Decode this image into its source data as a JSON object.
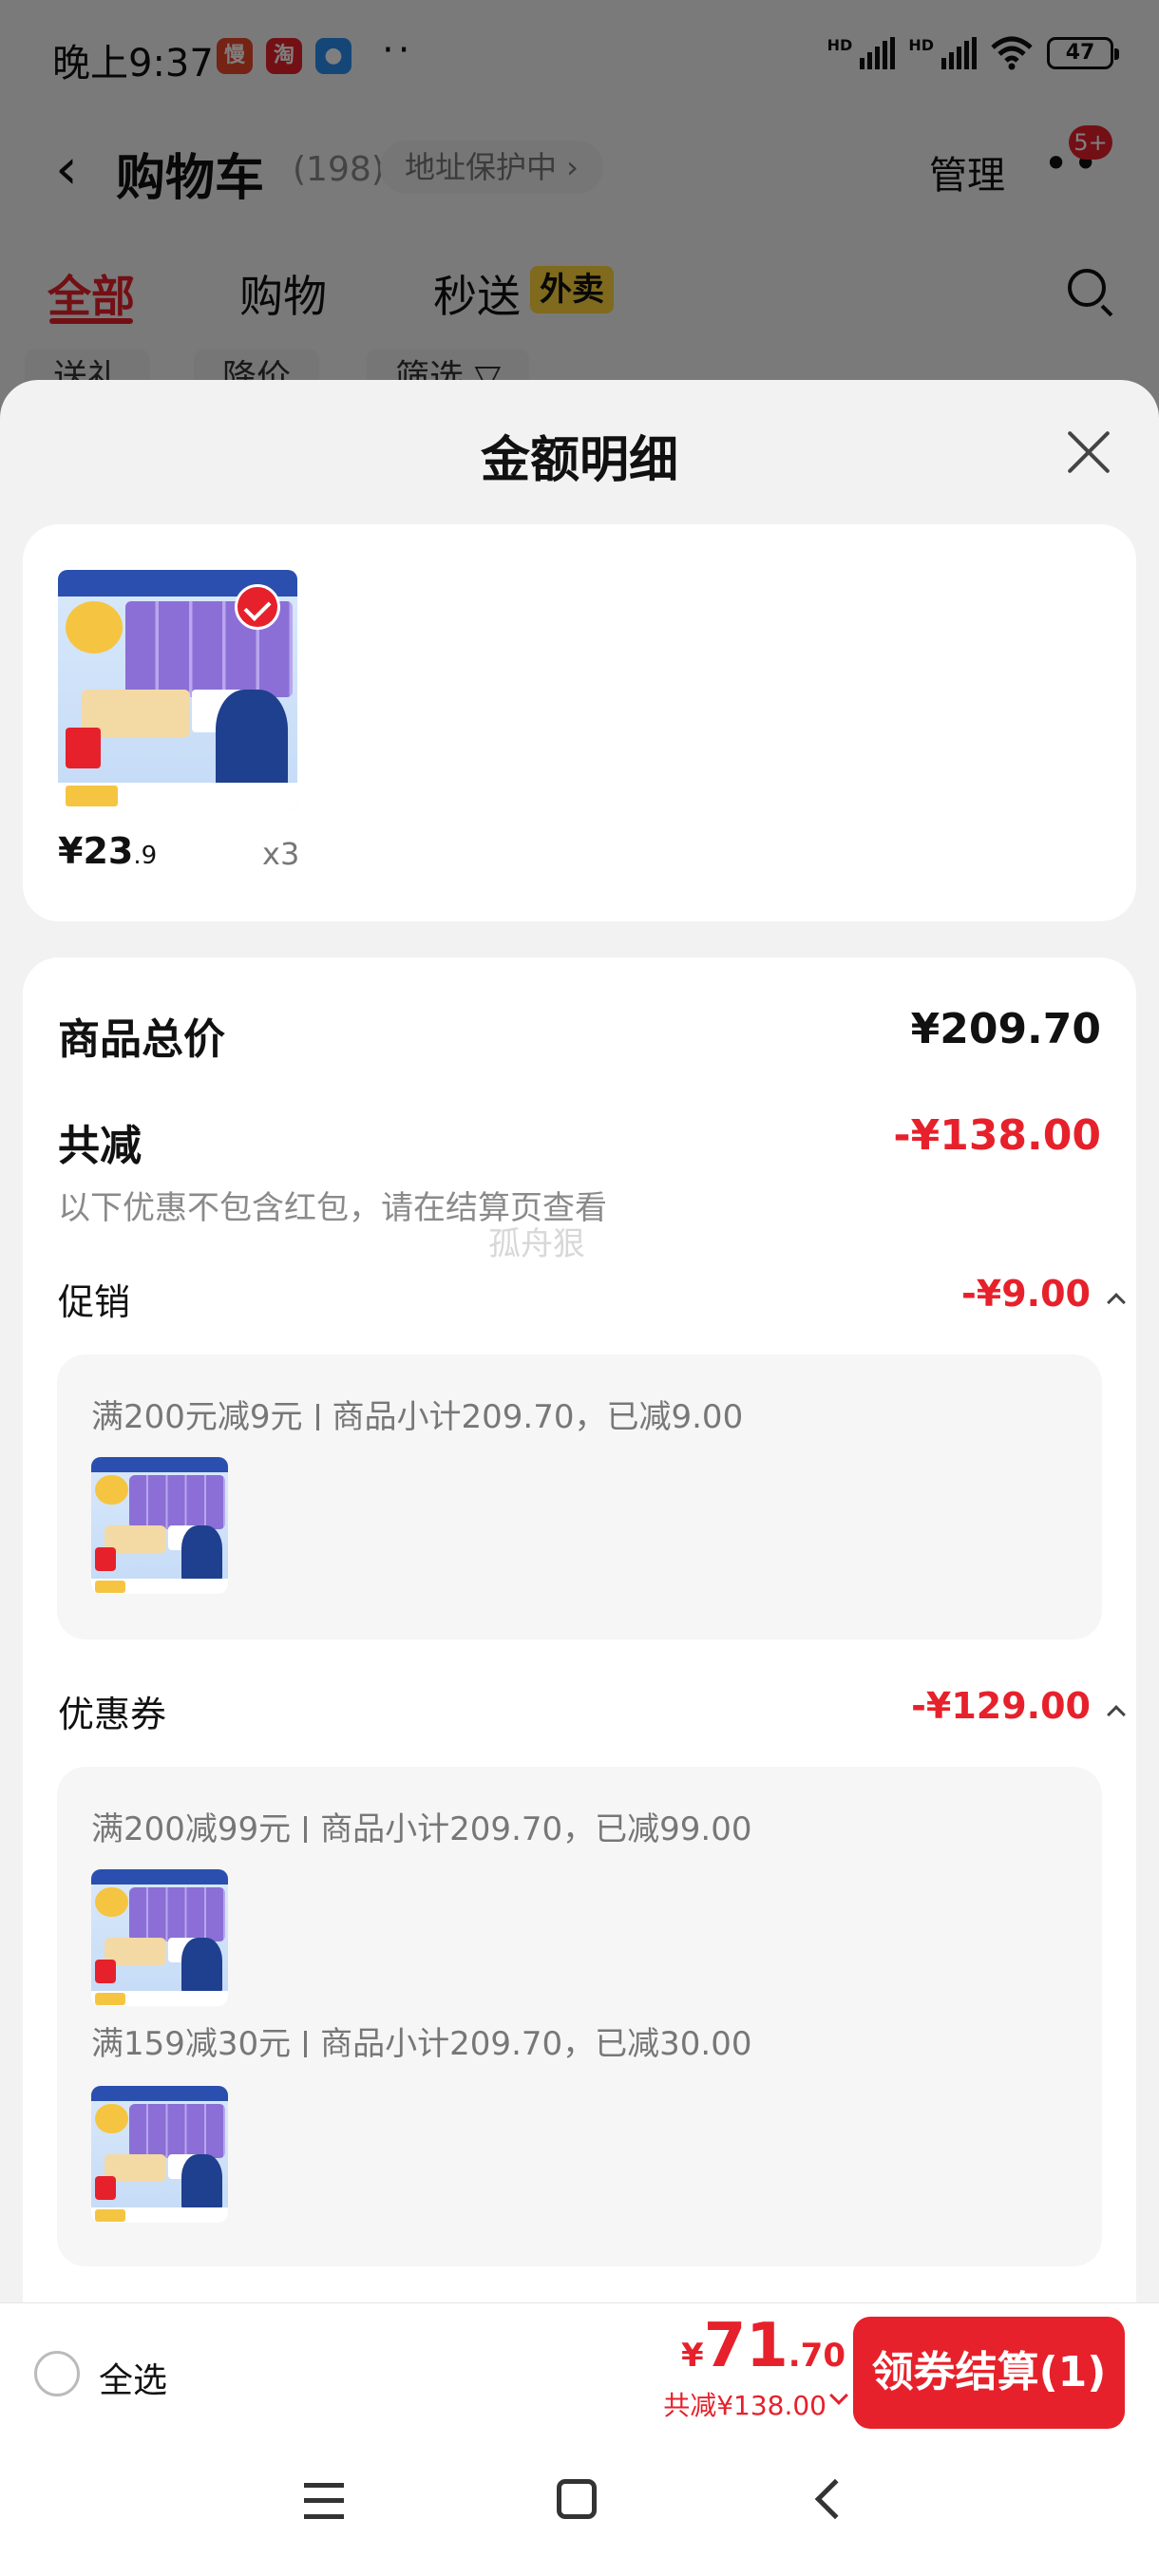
{
  "status_bar": {
    "time": "晚上9:37",
    "app_icons": [
      {
        "name": "app-slow-icon",
        "glyph": "慢",
        "color": "#e8472b"
      },
      {
        "name": "app-taobao-icon",
        "glyph": "淘",
        "color": "#e6212b"
      },
      {
        "name": "app-chat-icon",
        "glyph": "●",
        "color": "#2a8cf0"
      }
    ],
    "dots": "··",
    "hd1": "HD",
    "hd2": "HD",
    "battery": "47"
  },
  "header": {
    "title": "购物车",
    "count": "(198)",
    "address_pill": "地址保护中 ›",
    "manage": "管理",
    "more": "••",
    "badge": "5+"
  },
  "tabs": [
    {
      "label": "全部",
      "active": true
    },
    {
      "label": "购物",
      "active": false
    },
    {
      "label": "秒送",
      "active": false
    }
  ],
  "tab_badge": "外卖",
  "filter_chips": [
    "送礼",
    "降价",
    "筛选 ▽"
  ],
  "sheet": {
    "title": "金额明细",
    "product": {
      "price_main": "¥23",
      "price_decimal": ".9",
      "quantity": "x3"
    },
    "summary": {
      "total_label": "商品总价",
      "total_value": "¥209.70",
      "reduce_label": "共减",
      "reduce_value": "-¥138.00",
      "note": "以下优惠不包含红包，请在结算页查看",
      "watermark": "孤舟狠"
    },
    "promotion": {
      "label": "促销",
      "value": "-¥9.00",
      "rule": "满200元减9元",
      "detail": "商品小计209.70，已减9.00"
    },
    "coupon": {
      "label": "优惠券",
      "value": "-¥129.00",
      "items": [
        {
          "rule": "满200减99元",
          "detail": "商品小计209.70，已减99.00"
        },
        {
          "rule": "满159减30元",
          "detail": "商品小计209.70，已减30.00"
        }
      ]
    }
  },
  "bottom_bar": {
    "select_all": "全选",
    "currency": "¥",
    "price_int": "71",
    "price_dec": ".70",
    "total_reduce": "共减¥138.00",
    "checkout": "领券结算(1)"
  },
  "colors": {
    "accent": "#e6212b",
    "tab_badge": "#ffd43b"
  }
}
